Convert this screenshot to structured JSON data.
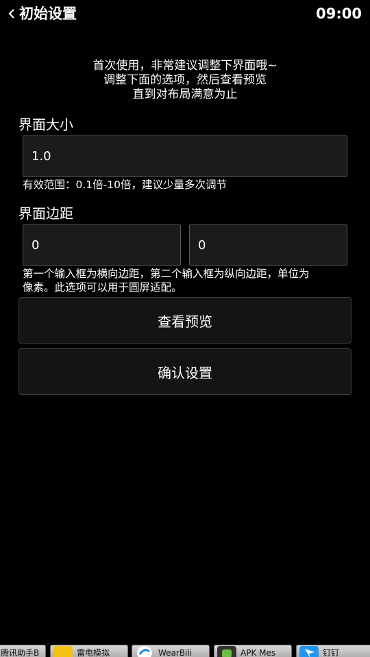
{
  "header": {
    "title": "初始设置",
    "time": "09:00"
  },
  "intro": {
    "lines": [
      "首次使用，非常建议调整下界面哦~",
      "调整下面的选项，然后查看预览",
      "直到对布局满意为止"
    ]
  },
  "ui_scale": {
    "label": "界面大小",
    "value": "1.0",
    "hint": "有效范围：0.1倍-10倍，建议少量多次调节"
  },
  "ui_margin": {
    "label": "界面边距",
    "horizontal_value": "0",
    "vertical_value": "0",
    "hint_lines": [
      "第一个输入框为横向边距，第二个输入框为纵向边距，单位为",
      "像素。此选项可以用于圆屏适配。"
    ]
  },
  "buttons": {
    "preview": "查看预览",
    "confirm": "确认设置"
  },
  "taskbar": {
    "items": [
      {
        "label": "腾讯助手B",
        "icon": "app-icon",
        "color": "#3a7bd5"
      },
      {
        "label": "雷电模拟",
        "icon": "thunder-emulator-icon",
        "color": "#f2c40f"
      },
      {
        "label": "WearBili",
        "icon": "wearbili-icon",
        "color": "#1e88e5"
      },
      {
        "label": "APK Mes",
        "icon": "android-icon",
        "color": "#6abf40"
      },
      {
        "label": "钉钉",
        "icon": "dingtalk-icon",
        "color": "#2196f3"
      }
    ]
  }
}
